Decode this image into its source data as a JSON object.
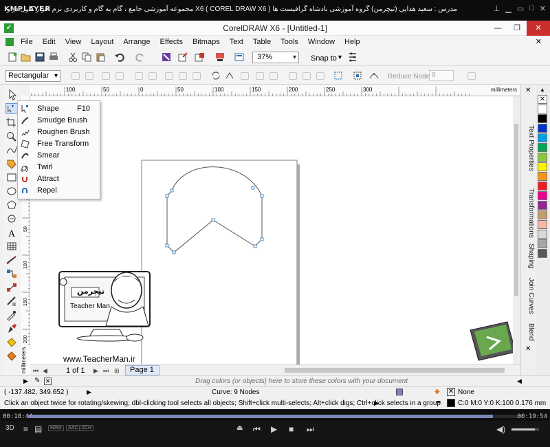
{
  "player": {
    "logo": "KMPLAYER",
    "title": "مجموعه آموزشی جامع ، گام به گام و کاربردی نرم افزار کارل دراو X6 ( COREL DRAW X6 )   مدرس : سعید هدایی (تیچرمن) گروه آموزشی بادشاه گرافیست ها",
    "time_elapsed": "00:18:44",
    "time_total": "00:19:54",
    "progress_fraction": 0.94,
    "tags": [
      "H264",
      "AAC",
      "2CH"
    ],
    "controls": [
      "pin-icon",
      "minimize-icon",
      "restore-icon",
      "maximize-icon",
      "close-icon"
    ]
  },
  "app": {
    "title": "CorelDRAW X6 - [Untitled-1]",
    "menu": [
      "File",
      "Edit",
      "View",
      "Layout",
      "Arrange",
      "Effects",
      "Bitmaps",
      "Text",
      "Table",
      "Tools",
      "Window",
      "Help"
    ]
  },
  "toolbar": {
    "zoom": "37%",
    "snap_to": "Snap to"
  },
  "propertybar": {
    "shape_mode": "Rectangular",
    "reduce_nodes_label": "Reduce Nodes",
    "reduce_nodes_value": "0"
  },
  "ruler": {
    "unit": "millimeters",
    "top_labels": [
      "100",
      "50",
      "0",
      "50",
      "100",
      "150",
      "200",
      "250",
      "300"
    ],
    "left_labels": [
      "100",
      "50",
      "0",
      "50",
      "100",
      "150",
      "200"
    ]
  },
  "flyout": {
    "items": [
      {
        "label": "Shape",
        "shortcut": "F10",
        "icon": "shape-tool-icon"
      },
      {
        "label": "Smudge Brush",
        "shortcut": "",
        "icon": "smudge-brush-icon"
      },
      {
        "label": "Roughen Brush",
        "shortcut": "",
        "icon": "roughen-brush-icon"
      },
      {
        "label": "Free Transform",
        "shortcut": "",
        "icon": "free-transform-icon"
      },
      {
        "label": "Smear",
        "shortcut": "",
        "icon": "smear-icon"
      },
      {
        "label": "Twirl",
        "shortcut": "",
        "icon": "twirl-icon"
      },
      {
        "label": "Attract",
        "shortcut": "",
        "icon": "attract-icon"
      },
      {
        "label": "Repel",
        "shortcut": "",
        "icon": "repel-icon"
      }
    ]
  },
  "watermark": {
    "brand": "تیچرمن",
    "tagline": "Teacher Man",
    "url": "www.TeacherMan.ir"
  },
  "page_nav": {
    "count": "1 of 1",
    "tab": "Page 1"
  },
  "dockers": [
    "Text Properties",
    "Transformations",
    "Shaping",
    "Join Curves",
    "Blend"
  ],
  "palette": [
    "#ffffff",
    "#000000",
    "#0033cc",
    "#00a0e9",
    "#00a651",
    "#8cc63f",
    "#fff200",
    "#f7941d",
    "#ed1c24",
    "#ec008c",
    "#92278f",
    "#c69c6d",
    "#f7b7a3",
    "#d9d9d9",
    "#a6a6a6",
    "#595959"
  ],
  "docpalette": {
    "hint": "Drag colors (or objects) here to store these colors with your document"
  },
  "status": {
    "coords": "( -137.482, 349.652 )",
    "selection": "Curve: 9 Nodes",
    "fill": "None",
    "outline": "C:0 M:0 Y:0 K:100  0.176 mm",
    "hint": "Click an object twice for rotating/skewing; dbl-clicking tool selects all objects; Shift+click multi-selects; Alt+click digs; Ctrl+click selects in a group"
  }
}
